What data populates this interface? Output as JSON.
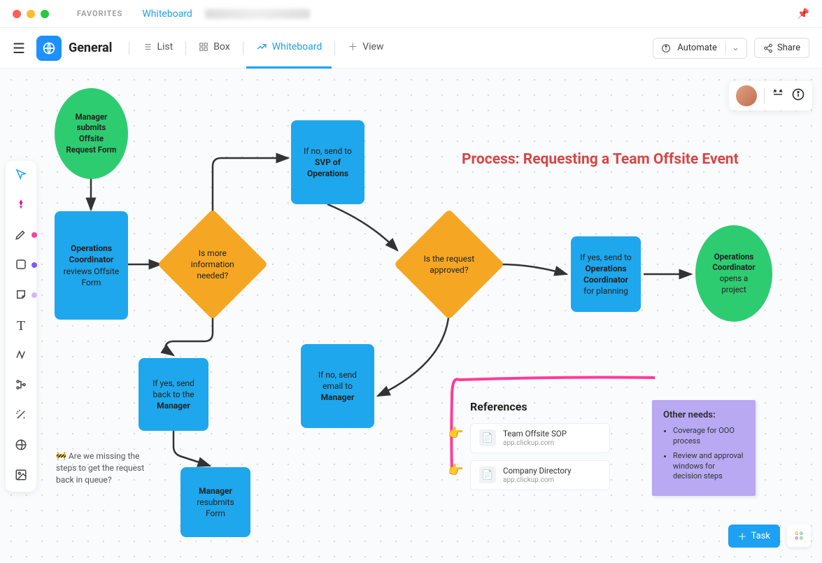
{
  "titlebar": {
    "favorites": "FAVORITES",
    "breadcrumb": "Whiteboard"
  },
  "header": {
    "space_name": "General",
    "views": {
      "list": "List",
      "box": "Box",
      "whiteboard": "Whiteboard",
      "add": "View"
    },
    "automate": "Automate",
    "share": "Share"
  },
  "process_title": "Process: Requesting a Team Offsite Event",
  "nodes": {
    "start": {
      "line1": "Manager",
      "line2": "submits",
      "line3": "Offsite",
      "line4": "Request Form"
    },
    "review": {
      "bold1": "Operations",
      "bold2": "Coordinator",
      "rest": "reviews Offsite Form"
    },
    "more_info": "Is more information needed?",
    "svp": {
      "pre": "If no, send to",
      "bold1": "SVP of",
      "bold2": "Operations"
    },
    "approved": "Is the request approved?",
    "send_mgr": {
      "pre1": "If yes, send",
      "pre2": "back to the",
      "bold": "Manager"
    },
    "resubmit": {
      "bold": "Manager",
      "rest": "resubmits Form"
    },
    "email_mgr": {
      "pre1": "If no, send",
      "pre2": "email to",
      "bold": "Manager"
    },
    "plan": {
      "pre": "If yes, send to",
      "bold1": "Operations",
      "bold2": "Coordinator",
      "rest": "for planning"
    },
    "end": {
      "bold1": "Operations",
      "bold2": "Coordinator",
      "rest1": "opens a",
      "rest2": "project"
    }
  },
  "comment": "🚧 Are we missing the steps to get the request back in queue?",
  "references": {
    "title": "References",
    "items": [
      {
        "title": "Team Offsite SOP",
        "sub": "app.clickup.com"
      },
      {
        "title": "Company Directory",
        "sub": "app.clickup.com"
      }
    ]
  },
  "needs": {
    "title": "Other needs:",
    "items": [
      "Coverage for OOO process",
      "Review and approval windows for decision steps"
    ]
  },
  "task_button": "Task"
}
